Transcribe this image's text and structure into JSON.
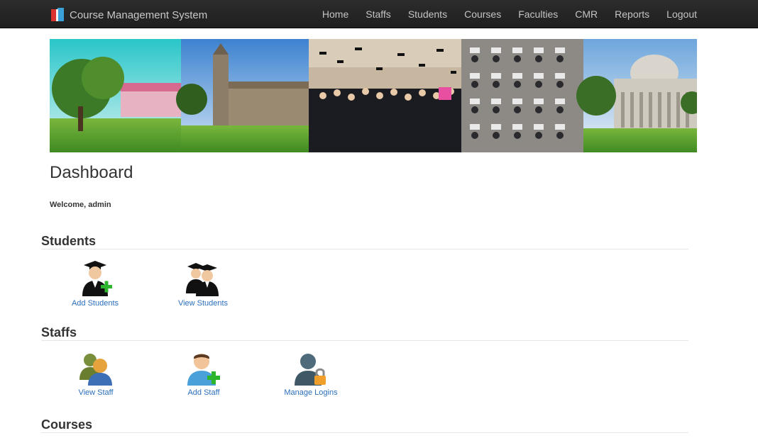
{
  "app": {
    "brand": "Course Management System"
  },
  "nav": {
    "items": [
      "Home",
      "Staffs",
      "Students",
      "Courses",
      "Faculties",
      "CMR",
      "Reports",
      "Logout"
    ]
  },
  "page": {
    "title": "Dashboard",
    "welcome": "Welcome, admin"
  },
  "sections": {
    "students": {
      "title": "Students",
      "tiles": [
        {
          "label": "Add Students",
          "icon": "graduate-add-icon"
        },
        {
          "label": "View Students",
          "icon": "graduates-group-icon"
        }
      ]
    },
    "staffs": {
      "title": "Staffs",
      "tiles": [
        {
          "label": "View Staff",
          "icon": "staff-group-icon"
        },
        {
          "label": "Add Staff",
          "icon": "user-add-icon"
        },
        {
          "label": "Manage Logins",
          "icon": "user-lock-icon"
        }
      ]
    },
    "courses": {
      "title": "Courses"
    }
  },
  "colors": {
    "navbar": "#222222",
    "link": "#2a6ebb",
    "add_green": "#2db52d"
  }
}
